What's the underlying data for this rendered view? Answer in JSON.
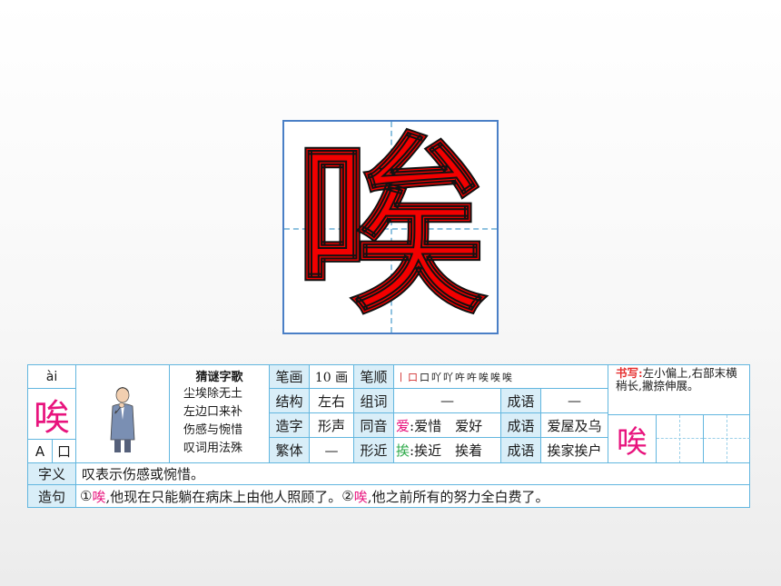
{
  "big_character": "唉",
  "card": {
    "pinyin": "ài",
    "character": "唉",
    "radical_letter": "A",
    "radical": "口",
    "riddle_title": "猜谜字歌",
    "riddle_lines": [
      "尘埃除无土",
      "左边口来补",
      "伤感与惋惜",
      "叹词用法殊"
    ],
    "strokes_label": "笔画",
    "strokes_value": "10 画",
    "order_label": "笔顺",
    "stroke_order": [
      "丨",
      "口",
      "口",
      "吖",
      "吖",
      "吘",
      "吘",
      "唉",
      "唉",
      "唉"
    ],
    "structure_label": "结构",
    "structure_value": "左右",
    "words_label": "组词",
    "words_value": "—",
    "idiom_label": "成语",
    "idiom_value": "—",
    "formation_label": "造字",
    "formation_value": "形声",
    "homophone_label": "同音",
    "homophone_char": "爱",
    "homophone_words": ":爱惜　爱好",
    "idiom2_label": "成语",
    "idiom2_value": "爱屋及乌",
    "traditional_label": "繁体",
    "traditional_value": "—",
    "similar_label": "形近",
    "similar_char": "挨",
    "similar_words": ":挨近　挨着",
    "idiom3_label": "成语",
    "idiom3_value": "挨家挨户",
    "writing_title": "书写:",
    "writing_text": "左小偏上,右部末横稍长,撇捺伸展。",
    "writing_char": "唉",
    "meaning_label": "字义",
    "meaning_text": "叹表示伤感或惋惜。",
    "sentence_label": "造句",
    "s1_num": "①",
    "s1_char": "唉",
    "s1_rest": ",他现在只能躺在病床上由他人照顾了。",
    "s2_num": "②",
    "s2_char": "唉",
    "s2_rest": ",他之前所有的努力全白费了。"
  },
  "colors": {
    "big_char": "#f20000",
    "accent_pink": "#e8137d",
    "border": "#62b6df",
    "header_bg": "#d9eef8"
  }
}
